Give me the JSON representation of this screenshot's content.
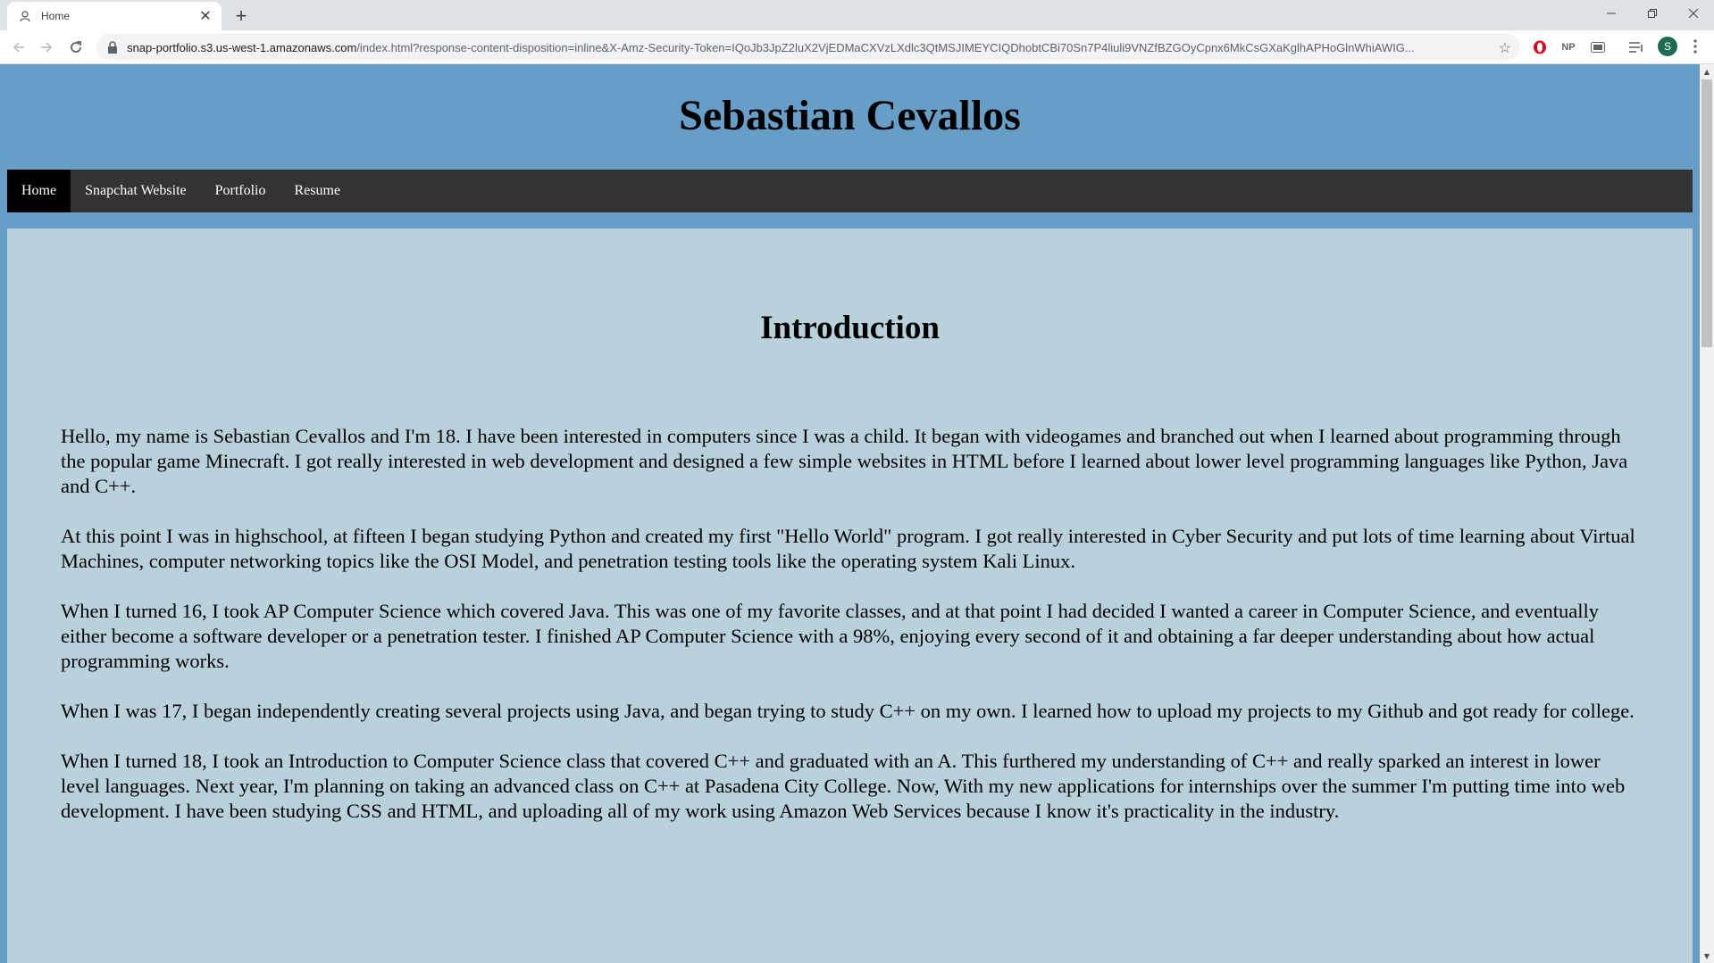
{
  "browser": {
    "tab_title": "Home",
    "new_tab_symbol": "+",
    "close_tab_symbol": "✕",
    "url_host": "snap-portfolio.s3.us-west-1.amazonaws.com",
    "url_rest": "/index.html?response-content-disposition=inline&X-Amz-Security-Token=IQoJb3JpZ2luX2VjEDMaCXVzLXdlc3QtMSJIMEYCIQDhobtCBi70Sn7P4liuli9VNZfBZGOyCpnx6MkCsGXaKglhAPHoGlnWhiAWIG...",
    "profile_initial": "S",
    "extensions": [
      "opera-icon",
      "NP",
      "cast-icon",
      "reading-list-icon"
    ],
    "extension_np_label": "NP"
  },
  "site": {
    "title": "Sebastian Cevallos",
    "nav": [
      {
        "label": "Home",
        "active": true
      },
      {
        "label": "Snapchat Website",
        "active": false
      },
      {
        "label": "Portfolio",
        "active": false
      },
      {
        "label": "Resume",
        "active": false
      }
    ],
    "heading": "Introduction",
    "paragraphs": [
      "Hello, my name is Sebastian Cevallos and I'm 18. I have been interested in computers since I was a child. It began with videogames and branched out when I learned about programming through the popular game Minecraft. I got really interested in web development and designed a few simple websites in HTML before I learned about lower level programming languages like Python, Java and C++.",
      "At this point I was in highschool, at fifteen I began studying Python and created my first \"Hello World\" program. I got really interested in Cyber Security and put lots of time learning about Virtual Machines, computer networking topics like the OSI Model, and penetration testing tools like the operating system Kali Linux.",
      "When I turned 16, I took AP Computer Science which covered Java. This was one of my favorite classes, and at that point I had decided I wanted a career in Computer Science, and eventually either become a software developer or a penetration tester. I finished AP Computer Science with a 98%, enjoying every second of it and obtaining a far deeper understanding about how actual programming works.",
      "When I was 17, I began independently creating several projects using Java, and began trying to study C++ on my own. I learned how to upload my projects to my Github and got ready for college.",
      "When I turned 18, I took an Introduction to Computer Science class that covered C++ and graduated with an A. This furthered my understanding of C++ and really sparked an interest in lower level languages. Next year, I'm planning on taking an advanced class on C++ at Pasadena City College. Now, With my new applications for internships over the summer I'm putting time into web development. I have been studying CSS and HTML, and uploading all of my work using Amazon Web Services because I know it's practicality in the industry."
    ]
  },
  "colors": {
    "page_background": "#679ec8",
    "nav_background": "#333333",
    "nav_active": "#000000",
    "content_background": "#b8d1db"
  }
}
